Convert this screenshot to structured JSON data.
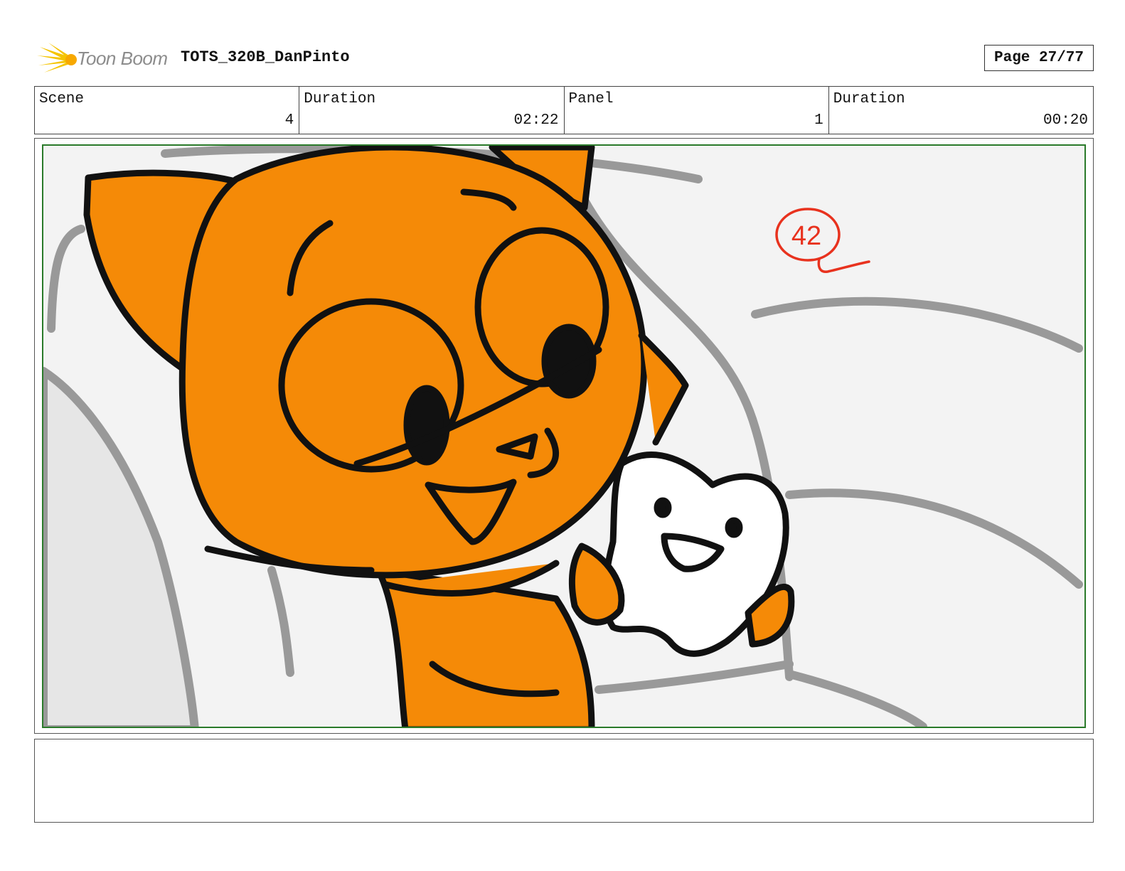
{
  "header": {
    "logo_text": "Toon Boom",
    "project_title": "TOTS_320B_DanPinto",
    "page_label": "Page 27/77"
  },
  "info": {
    "scene_label": "Scene",
    "scene_value": "4",
    "scene_duration_label": "Duration",
    "scene_duration_value": "02:22",
    "panel_label": "Panel",
    "panel_value": "1",
    "panel_duration_label": "Duration",
    "panel_duration_value": "00:20"
  },
  "panel": {
    "annotation_number": "42",
    "annotation_color": "#e8321e",
    "character_color": "#f58a07",
    "frame_border_color": "#2a7a2a"
  },
  "notes": {
    "text": ""
  }
}
